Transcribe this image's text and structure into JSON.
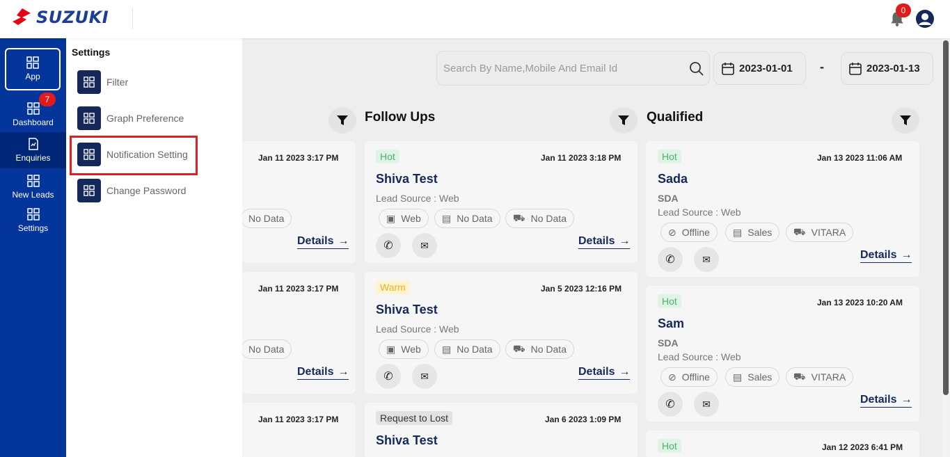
{
  "header": {
    "brand": "SUZUKI",
    "notification_count": "0",
    "accent": "#03359a",
    "logo_color": "#e30613"
  },
  "sidebar": {
    "items": [
      {
        "label": "App",
        "icon": "grid-icon"
      },
      {
        "label": "Dashboard",
        "icon": "grid-icon"
      },
      {
        "label": "Enquiries",
        "icon": "report-icon",
        "badge": "7"
      },
      {
        "label": "New Leads",
        "icon": "grid-icon"
      },
      {
        "label": "Settings",
        "icon": "grid-icon"
      }
    ]
  },
  "settings_panel": {
    "title": "Settings",
    "items": [
      {
        "label": "Filter"
      },
      {
        "label": "Graph Preference"
      },
      {
        "label": "Notification Setting"
      },
      {
        "label": "Change Password"
      }
    ]
  },
  "search": {
    "placeholder": "Search By Name,Mobile And Email Id",
    "date_from": "2023-01-01",
    "date_separator": "-",
    "date_to": "2023-01-13"
  },
  "columns": [
    {
      "title": "",
      "cards": [
        {
          "date": "Jan 11 2023 3:17 PM",
          "pill": "No Data",
          "details": "Details"
        },
        {
          "date": "Jan 11 2023 3:17 PM",
          "pill": "No Data",
          "details": "Details"
        },
        {
          "date": "Jan 11 2023 3:17 PM"
        }
      ]
    },
    {
      "title": "Follow Ups",
      "cards": [
        {
          "tag": "Hot",
          "date": "Jan 11 2023 3:18 PM",
          "name": "Shiva Test",
          "source": "Lead Source : Web",
          "pills": [
            "Web",
            "No Data",
            "No Data"
          ],
          "details": "Details"
        },
        {
          "tag": "Warm",
          "date": "Jan 5 2023 12:16 PM",
          "name": "Shiva Test",
          "source": "Lead Source : Web",
          "pills": [
            "Web",
            "No Data",
            "No Data"
          ],
          "details": "Details"
        },
        {
          "tag": "Request to Lost",
          "date": "Jan 6 2023 1:09 PM",
          "name": "Shiva Test"
        }
      ]
    },
    {
      "title": "Qualified",
      "cards": [
        {
          "tag": "Hot",
          "date": "Jan 13 2023 11:06 AM",
          "name": "Sada",
          "model": "SDA",
          "source": "Lead Source : Web",
          "pills": [
            "Offline",
            "Sales",
            "VITARA"
          ],
          "details": "Details"
        },
        {
          "tag": "Hot",
          "date": "Jan 13 2023 10:20 AM",
          "name": "Sam",
          "model": "SDA",
          "source": "Lead Source : Web",
          "pills": [
            "Offline",
            "Sales",
            "VITARA"
          ],
          "details": "Details"
        },
        {
          "tag": "Hot",
          "date": "Jan 12 2023 6:41 PM"
        }
      ]
    }
  ]
}
